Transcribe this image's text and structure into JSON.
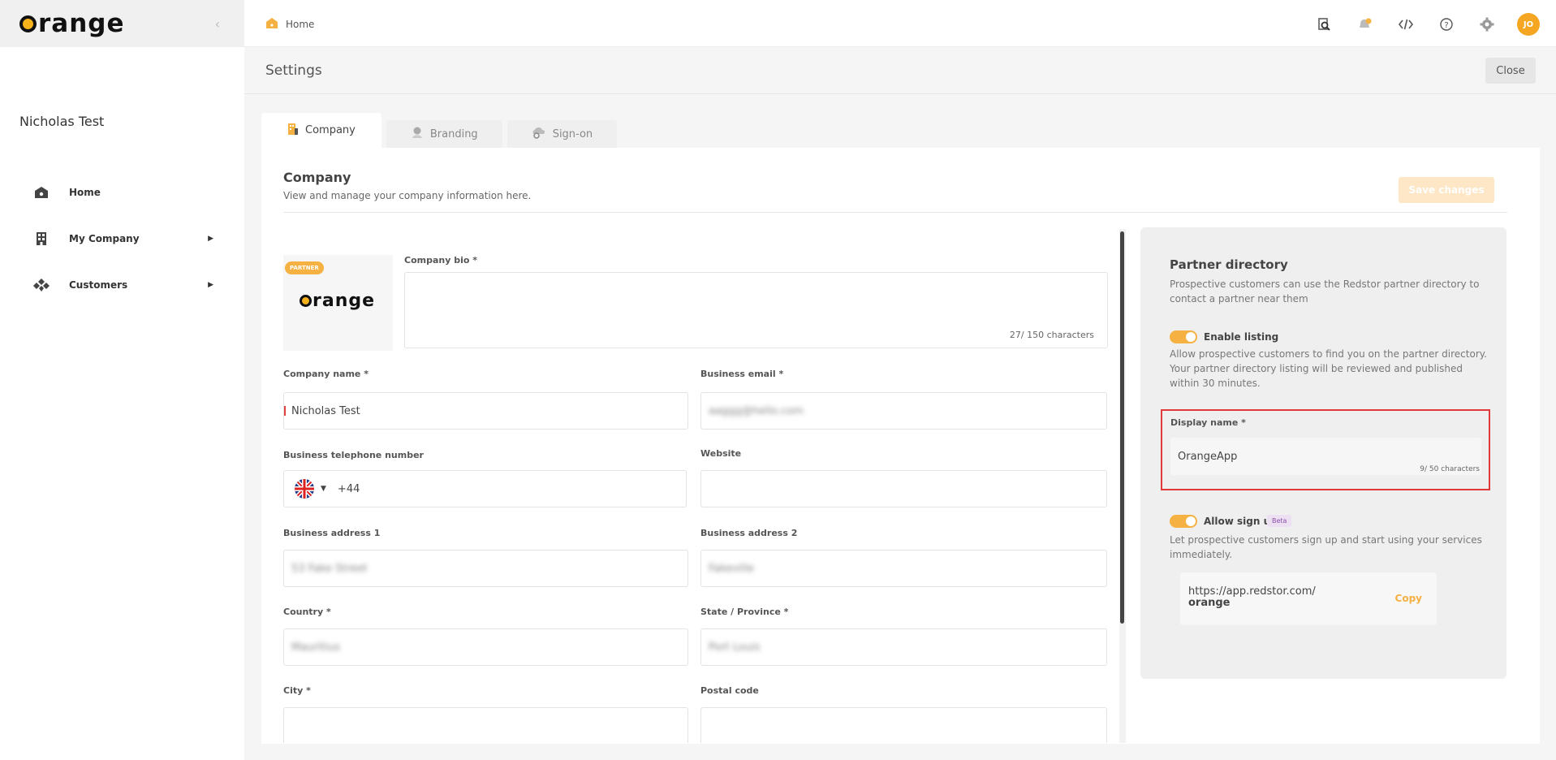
{
  "brand": {
    "logo_text": "range",
    "accent": "#f5b141"
  },
  "sidebar": {
    "user_name": "Nicholas Test",
    "items": [
      {
        "label": "Home",
        "icon": "home-icon"
      },
      {
        "label": "My Company",
        "icon": "building-icon"
      },
      {
        "label": "Customers",
        "icon": "customers-icon"
      }
    ]
  },
  "topbar": {
    "breadcrumb": "Home",
    "avatar_initials": "JO",
    "icons": [
      "search-icon",
      "notifications-icon",
      "code-icon",
      "help-icon",
      "gear-icon"
    ]
  },
  "page": {
    "title": "Settings",
    "close_label": "Close"
  },
  "tabs": [
    {
      "label": "Company",
      "icon": "company-icon"
    },
    {
      "label": "Branding",
      "icon": "branding-icon"
    },
    {
      "label": "Sign-on",
      "icon": "signon-icon"
    }
  ],
  "company": {
    "title": "Company",
    "description": "View and manage your company information here.",
    "save_label": "Save changes",
    "partner_badge": "PARTNER",
    "bio_label": "Company bio *",
    "bio_count": "27/ 150 characters",
    "company_name_label": "Company name *",
    "company_name_value": "Nicholas Test",
    "business_email_label": "Business email *",
    "business_email_value": "aaggg@hello.com",
    "telephone_label": "Business telephone number",
    "telephone_value": "+44",
    "website_label": "Website",
    "address1_label": "Business address 1",
    "address1_value": "53 Fake Street",
    "address2_label": "Business address 2",
    "address2_value": "Fakeville",
    "country_label": "Country *",
    "country_value": "Mauritius",
    "state_label": "State / Province *",
    "state_value": "Port Louis",
    "city_label": "City *",
    "postal_label": "Postal code"
  },
  "partner_directory": {
    "title": "Partner directory",
    "description": "Prospective customers can use the Redstor partner directory to contact a partner near them",
    "enable_listing_label": "Enable listing",
    "enable_listing_on": true,
    "enable_listing_desc": "Allow prospective customers to find you on the partner directory. Your partner directory listing will be reviewed and published within 30 minutes.",
    "display_name_label": "Display name *",
    "display_name_value": "OrangeApp",
    "display_name_count": "9/ 50 characters",
    "allow_signup_label": "Allow sign up",
    "allow_signup_on": true,
    "beta_label": "Beta",
    "allow_signup_desc": "Let prospective customers sign up and start using your services immediately.",
    "signup_url": "https://app.redstor.com/",
    "signup_slug": "orange",
    "copy_label": "Copy"
  }
}
